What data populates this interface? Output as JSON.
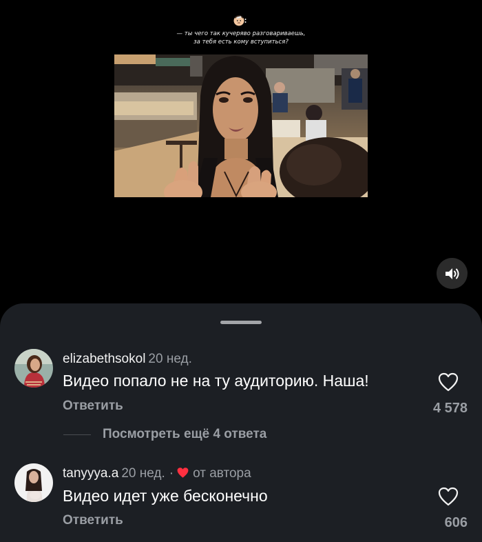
{
  "caption": {
    "emoji_icon": "face-with-bandage-emoji",
    "line1": "— ты чего так кучеряво разговариваешь,",
    "line2": "за тебя есть кому вступиться?"
  },
  "video": {
    "icon": "video-frame"
  },
  "sound_button": {
    "icon": "speaker-sound-icon"
  },
  "sheet": {
    "comments": [
      {
        "username": "elizabethsokol",
        "time": "20 нед.",
        "text": "Видео попало не на ту аудиторию. Наша!",
        "reply_label": "Ответить",
        "likes": "4 578"
      },
      {
        "username": "tanyyya.a",
        "time": "20 нед.",
        "dot": "·",
        "author_label": "от автора",
        "text": "Видео идет уже бесконечно",
        "reply_label": "Ответить",
        "likes": "606"
      }
    ],
    "more_replies": "Посмотреть ещё 4 ответа"
  },
  "colors": {
    "sheet_bg": "#1c1f24",
    "secondary_text": "#9a9ea4",
    "author_heart": "#ff3040"
  }
}
